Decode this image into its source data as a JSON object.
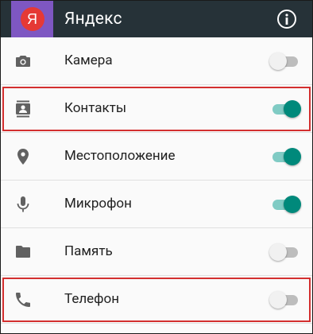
{
  "app": {
    "logo_letter": "Я",
    "title": "Яндекс",
    "info_icon": "info-icon"
  },
  "colors": {
    "appbar": "#263238",
    "logo_bg": "#7e57c2",
    "logo_circle": "#e53935",
    "switch_on_thumb": "#00897b",
    "switch_on_track": "#80cbc4",
    "highlight": "#d32f2f"
  },
  "permissions": [
    {
      "label": "Камера",
      "icon": "camera-icon",
      "enabled": false,
      "highlighted": false
    },
    {
      "label": "Контакты",
      "icon": "contacts-icon",
      "enabled": true,
      "highlighted": true
    },
    {
      "label": "Местоположение",
      "icon": "location-icon",
      "enabled": true,
      "highlighted": false
    },
    {
      "label": "Микрофон",
      "icon": "microphone-icon",
      "enabled": true,
      "highlighted": false
    },
    {
      "label": "Память",
      "icon": "folder-icon",
      "enabled": false,
      "highlighted": false
    },
    {
      "label": "Телефон",
      "icon": "phone-icon",
      "enabled": false,
      "highlighted": true
    }
  ]
}
